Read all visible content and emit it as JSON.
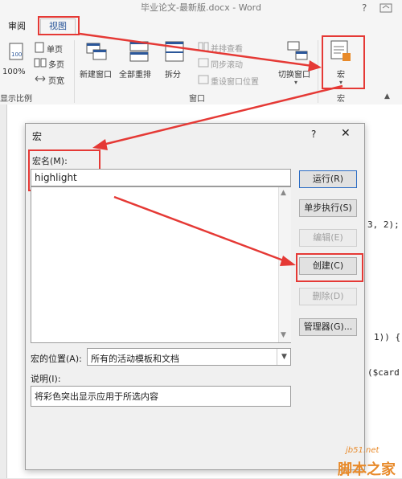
{
  "window": {
    "title": "毕业论文-最新版.docx - Word",
    "help": "?"
  },
  "tabs": [
    {
      "label": "审阅"
    },
    {
      "label": "视图"
    }
  ],
  "ribbon": {
    "zoom_100": "100%",
    "zoom_icon_text": "100",
    "view_single": "单页",
    "view_multi": "多页",
    "view_width": "页宽",
    "new_window": "新建窗口",
    "arrange_all": "全部重排",
    "split": "拆分",
    "side_by_side": "并排查看",
    "sync_scroll": "同步滚动",
    "reset_position": "重设窗口位置",
    "switch_window": "切换窗口",
    "macros": "宏",
    "group_zoom": "显示比例",
    "group_window": "窗口",
    "group_macros": "宏"
  },
  "document": {
    "code_lines": [
      "3, 2);",
      "1)) {",
      "($card"
    ]
  },
  "dialog": {
    "title": "宏",
    "help": "?",
    "close": "✕",
    "macro_name_label": "宏名(M):",
    "macro_name_value": "highlight",
    "buttons": {
      "run": "运行(R)",
      "step": "单步执行(S)",
      "edit": "编辑(E)",
      "create": "创建(C)",
      "delete": "删除(D)",
      "organizer": "管理器(G)..."
    },
    "location_label": "宏的位置(A):",
    "location_value": "所有的活动模板和文档",
    "description_label": "说明(I):",
    "description_value": "将彩色突出显示应用于所选内容"
  },
  "watermark": {
    "site": "jb51.net",
    "name": "脚本之家"
  },
  "colors": {
    "accent": "#2b579a",
    "annotation": "#e53935",
    "dialog_bg": "#f0f0f0"
  }
}
